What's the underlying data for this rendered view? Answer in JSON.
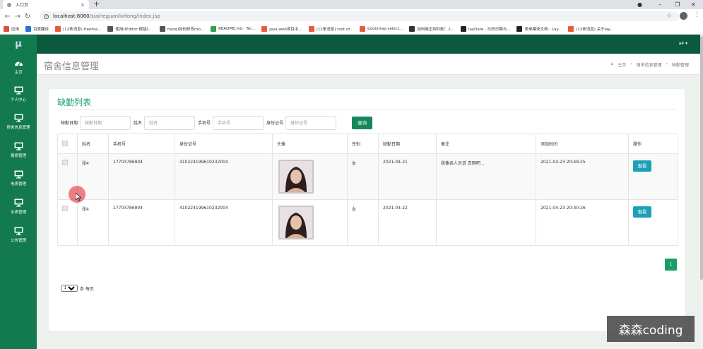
{
  "browser": {
    "tab_title": "入口页",
    "tab_close": "×",
    "new_tab": "+",
    "controls": {
      "minimize": "–",
      "restore": "❐",
      "close": "✕"
    },
    "url_host": "localhost:8080",
    "url_path": "/susheguanlixitong/index.jsp",
    "bookmarks": [
      {
        "label": "应用",
        "color": "#e04b3a"
      },
      {
        "label": "百度翻译",
        "color": "#2b6fd6"
      },
      {
        "label": "(12条消息) freema...",
        "color": "#e85a3c"
      },
      {
        "label": "使用UEditor 报错C...",
        "color": "#555555"
      },
      {
        "label": "mysql如何修改roo...",
        "color": "#555555"
      },
      {
        "label": "README.md · Ter...",
        "color": "#2aa14a"
      },
      {
        "label": "java web项目中...",
        "color": "#e85a3c"
      },
      {
        "label": "(12条消息) root of...",
        "color": "#e85a3c"
      },
      {
        "label": "bootstrap-select...",
        "color": "#e85a3c"
      },
      {
        "label": "如何用正则匹配：2...",
        "color": "#333333"
      },
      {
        "label": "layDate - 日历日期与...",
        "color": "#222222"
      },
      {
        "label": "表单模块文档 - Lay...",
        "color": "#222222"
      },
      {
        "label": "(12条消息) 关于lay...",
        "color": "#e85a3c"
      }
    ]
  },
  "app": {
    "logo": "μ",
    "user_menu": "a4 ▾",
    "sidebar": [
      {
        "label": "主页",
        "icon": "dashboard-icon"
      },
      {
        "label": "个人中心",
        "icon": "monitor-icon"
      },
      {
        "label": "宿舍信息管理",
        "icon": "monitor-icon"
      },
      {
        "label": "报修管理",
        "icon": "monitor-icon"
      },
      {
        "label": "电表管理",
        "icon": "monitor-icon"
      },
      {
        "label": "水表管理",
        "icon": "monitor-icon"
      },
      {
        "label": "公告管理",
        "icon": "monitor-icon"
      }
    ],
    "page_title": "宿舍信息管理",
    "breadcrumb": [
      "主页",
      "宿舍信息管理",
      "缺勤管理"
    ],
    "breadcrumb_sep": "›",
    "list_title": "缺勤列表",
    "filters": [
      {
        "label": "缺勤日期",
        "placeholder": "缺勤日期"
      },
      {
        "label": "姓名",
        "placeholder": "姓名"
      },
      {
        "label": "手机号",
        "placeholder": "手机号"
      },
      {
        "label": "身份证号",
        "placeholder": "身份证号"
      }
    ],
    "query_button": "查询",
    "columns": [
      "姓名",
      "手机号",
      "身份证号",
      "头像",
      "性别",
      "缺勤日期",
      "备注",
      "添加时间",
      "操作"
    ],
    "rows": [
      {
        "name": "张4",
        "phone": "17703786904",
        "id_card": "410224199610232004",
        "gender": "女",
        "absence_date": "2021-04-21",
        "note": "我像亲人员说 去网吧...",
        "added": "2021-04-23 20:49:25",
        "action": "查看"
      },
      {
        "name": "张4",
        "phone": "17703786904",
        "id_card": "410224199610232004",
        "gender": "女",
        "absence_date": "2021-04-22",
        "note": "",
        "added": "2021-04-23 20:30:26",
        "action": "查看"
      }
    ],
    "page_size": "10",
    "page_size_suffix": "条 每页",
    "current_page": "1"
  },
  "watermark": "森森coding",
  "colors": {
    "topbar": "#0b5a3d",
    "sidebar": "#127a4e",
    "accent": "#1a9d68",
    "view_button": "#1e9fb8"
  }
}
